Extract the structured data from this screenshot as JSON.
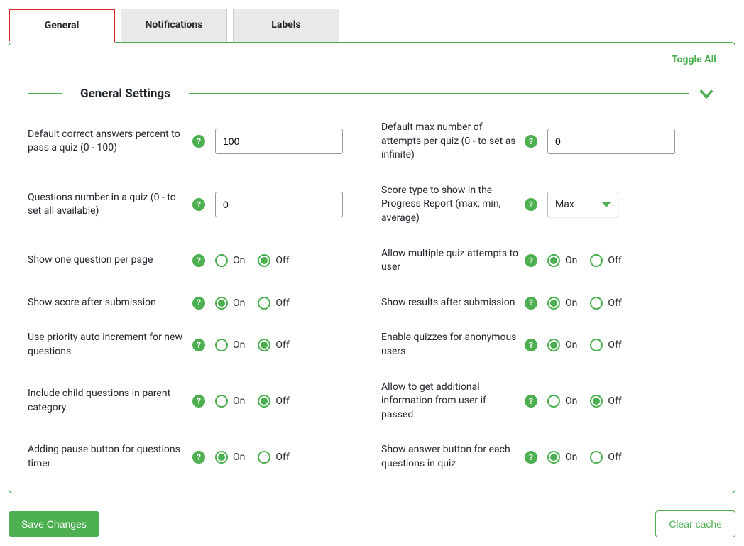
{
  "tabs": {
    "general": "General",
    "notifications": "Notifications",
    "labels": "Labels"
  },
  "toggle_all": "Toggle All",
  "section_title": "General Settings",
  "radio_labels": {
    "on": "On",
    "off": "Off"
  },
  "select": {
    "score_type": "Max"
  },
  "settings": {
    "pass_percent": {
      "label": "Default correct answers percent to pass a quiz (0 - 100)",
      "value": "100"
    },
    "max_attempts": {
      "label": "Default max number of attempts per quiz (0 - to set as infinite)",
      "value": "0"
    },
    "questions_number": {
      "label": "Questions number in a quiz (0 - to set all available)",
      "value": "0"
    },
    "score_type": {
      "label": "Score type to show in the Progress Report (max, min, average)"
    },
    "show_one_per_page": {
      "label": "Show one question per page",
      "value": "off"
    },
    "allow_multiple_attempts": {
      "label": "Allow multiple quiz attempts to user",
      "value": "on"
    },
    "show_score_after": {
      "label": "Show score after submission",
      "value": "on"
    },
    "show_results_after": {
      "label": "Show results after submission",
      "value": "on"
    },
    "priority_auto_increment": {
      "label": "Use priority auto increment for new questions",
      "value": "off"
    },
    "enable_anonymous": {
      "label": "Enable quizzes for anonymous users",
      "value": "on"
    },
    "include_child_questions": {
      "label": "Include child questions in parent category",
      "value": "off"
    },
    "allow_additional_info": {
      "label": "Allow to get additional information from user if passed",
      "value": "off"
    },
    "adding_pause_button": {
      "label": "Adding pause button for questions timer",
      "value": "on"
    },
    "show_answer_button": {
      "label": "Show answer button for each questions in quiz",
      "value": "on"
    }
  },
  "buttons": {
    "save": "Save Changes",
    "clear_cache": "Clear cache"
  }
}
